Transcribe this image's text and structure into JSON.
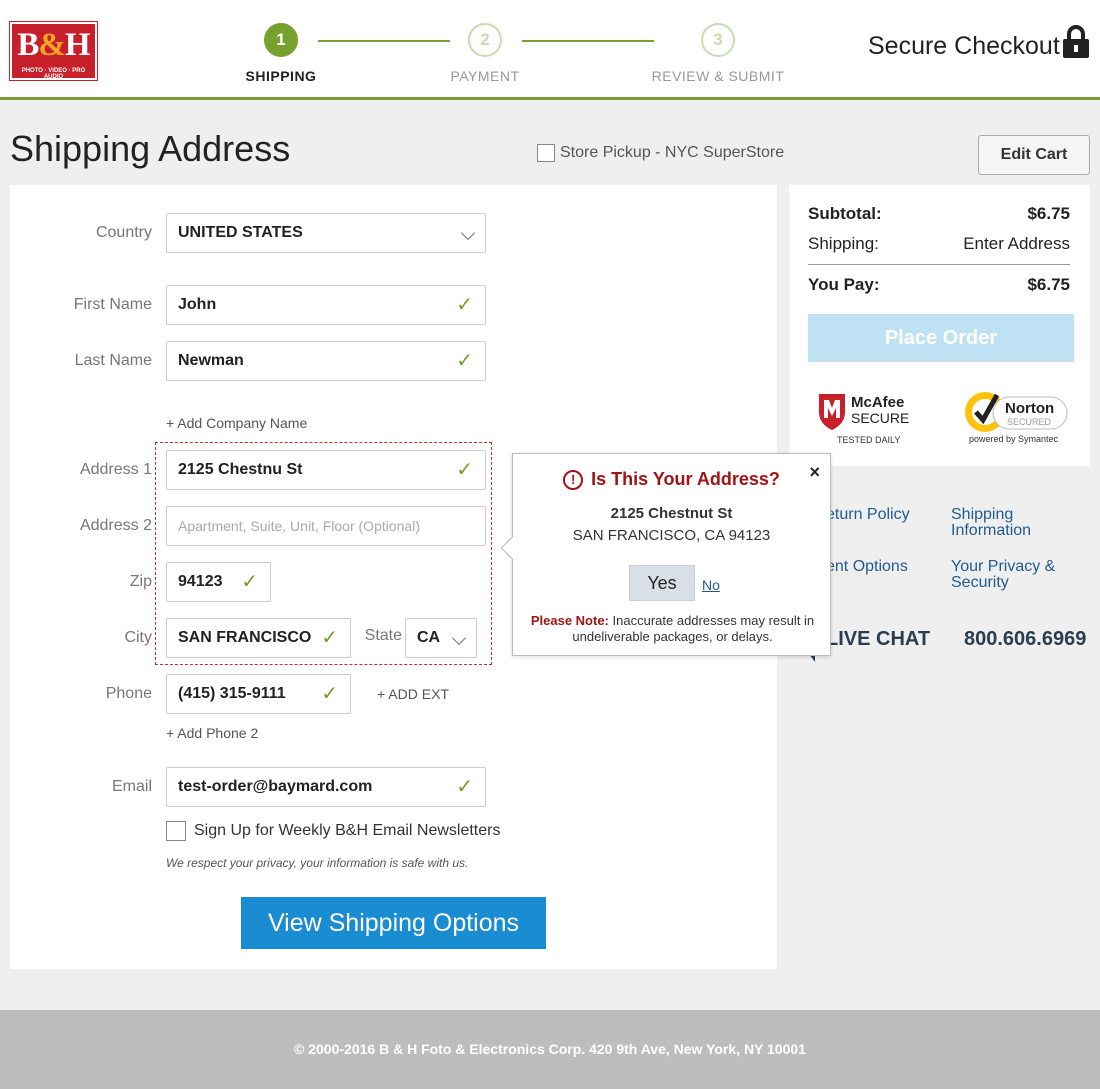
{
  "header": {
    "logo": {
      "main_b": "B",
      "amp": "&",
      "main_h": "H",
      "tagline": "PHOTO · VIDEO · PRO AUDIO"
    },
    "steps": [
      {
        "number": "1",
        "label": "SHIPPING"
      },
      {
        "number": "2",
        "label": "PAYMENT"
      },
      {
        "number": "3",
        "label": "REVIEW & SUBMIT"
      }
    ],
    "secure_checkout": "Secure Checkout",
    "colors": {
      "accent_green": "#75a12c",
      "brand_red": "#c8202b",
      "primary_blue": "#1a8cd2"
    }
  },
  "page": {
    "title": "Shipping Address",
    "store_pickup_label": "Store Pickup - NYC SuperStore",
    "edit_cart_label": "Edit Cart"
  },
  "form": {
    "country_label": "Country",
    "country_value": "UNITED STATES",
    "first_name_label": "First Name",
    "first_name_value": "John",
    "last_name_label": "Last Name",
    "last_name_value": "Newman",
    "add_company": "+ Add Company Name",
    "address1_label": "Address 1",
    "address1_value": "2125 Chestnu St",
    "address2_label": "Address 2",
    "address2_placeholder": "Apartment, Suite, Unit, Floor (Optional)",
    "zip_label": "Zip",
    "zip_value": "94123",
    "city_label": "City",
    "city_value": "SAN FRANCISCO",
    "state_label": "State",
    "state_value": "CA",
    "phone_label": "Phone",
    "phone_value": "(415) 315-9111",
    "add_ext": "+ ADD EXT",
    "add_phone2": "+ Add Phone 2",
    "email_label": "Email",
    "email_value": "test-order@baymard.com",
    "newsletter_label": "Sign Up for Weekly B&H Email Newsletters",
    "privacy_note": "We respect your privacy, your information is safe with us.",
    "view_shipping_button": "View Shipping Options"
  },
  "summary": {
    "subtotal_label": "Subtotal:",
    "subtotal_value": "$6.75",
    "shipping_label": "Shipping:",
    "shipping_value": "Enter Address",
    "you_pay_label": "You Pay:",
    "you_pay_value": "$6.75",
    "place_order_button": "Place Order",
    "mcafee": {
      "brand": "McAfee",
      "secure": "SECURE",
      "tested": "TESTED DAILY"
    },
    "norton": {
      "brand": "Norton",
      "secured": "SECURED",
      "powered": "powered by Symantec"
    }
  },
  "links": {
    "return_policy": "eturn Policy",
    "shipping_info_line1": "Shipping",
    "shipping_info_line2": "Information",
    "payment_options": "ent Options",
    "privacy_line1": "Your Privacy &",
    "privacy_line2": "Security",
    "live_chat": "LIVE CHAT",
    "phone": "800.606.6969"
  },
  "popover": {
    "close": "×",
    "icon": "!",
    "title": "Is This Your Address?",
    "address_line1": "2125 Chestnut St",
    "address_line2": "SAN FRANCISCO, CA 94123",
    "yes": "Yes",
    "no": "No",
    "note_bold": "Please Note:",
    "note_text": " Inaccurate addresses may result in undeliverable packages, or delays."
  },
  "footer": {
    "copyright": "© 2000-2016 B & H Foto & Electronics Corp. 420 9th Ave, New York, NY 10001"
  }
}
